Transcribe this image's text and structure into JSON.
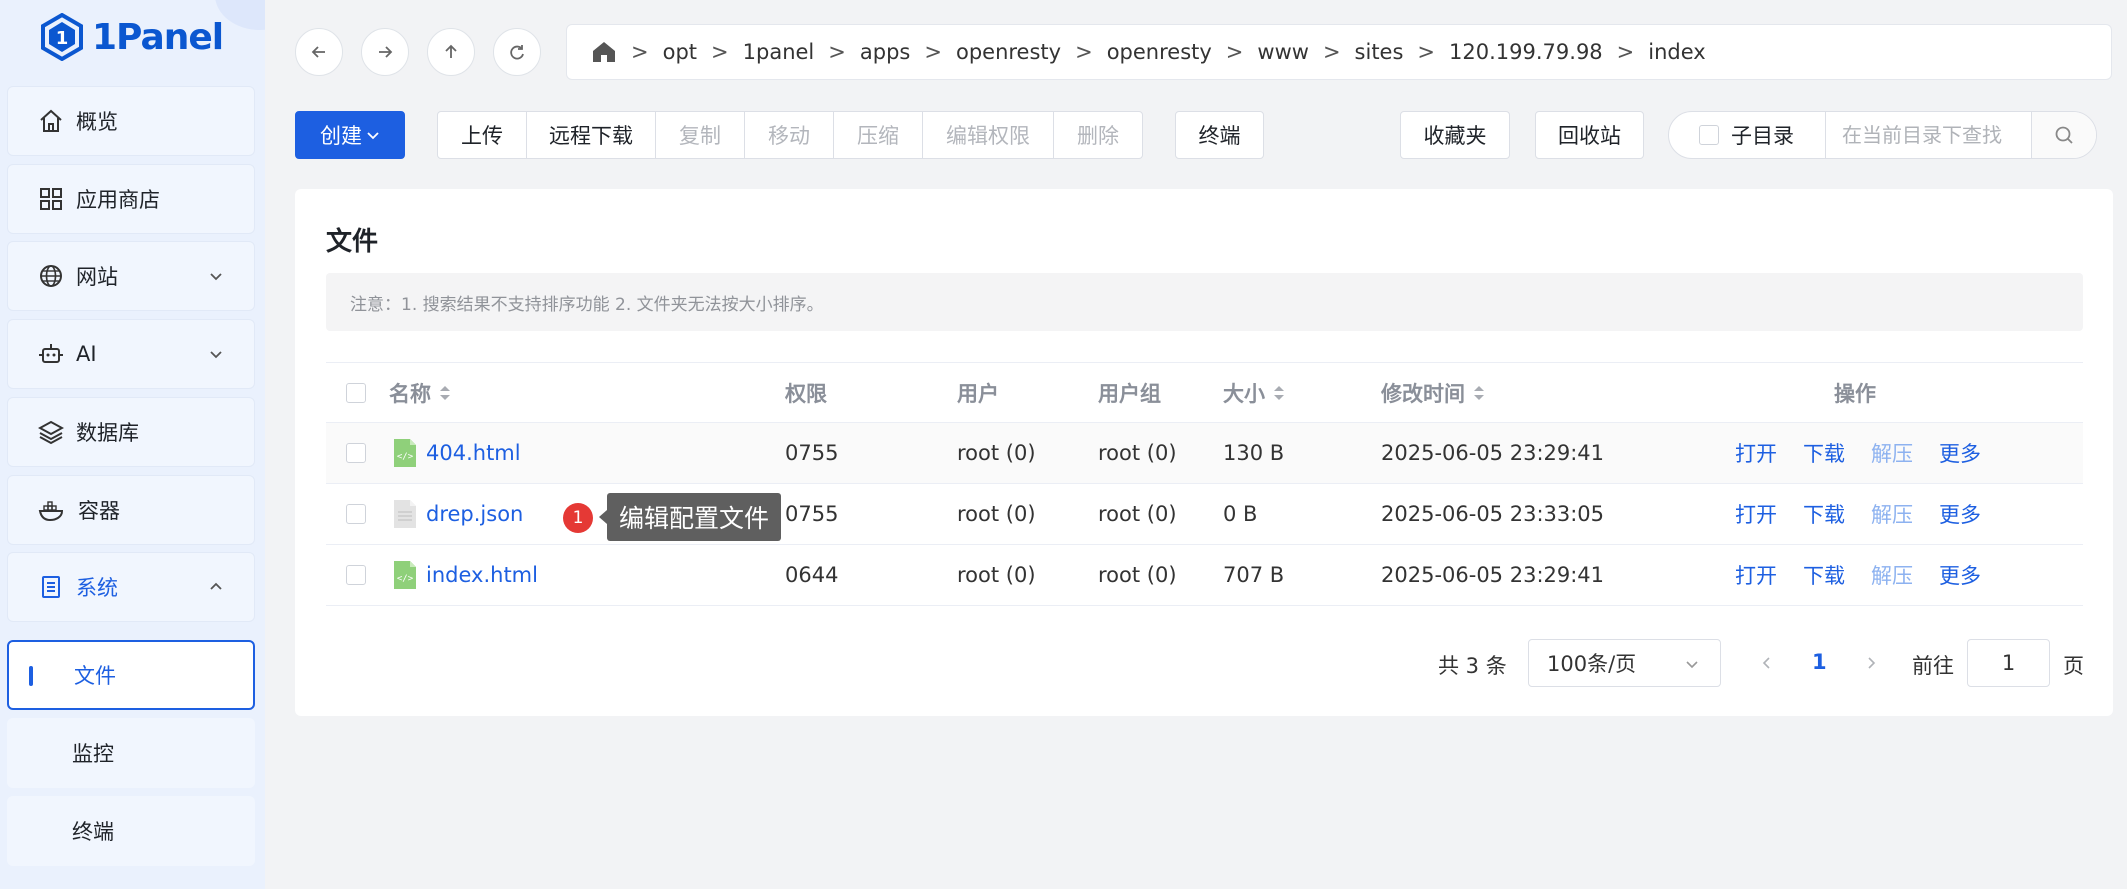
{
  "app": {
    "logo_text": "1Panel"
  },
  "sidebar": {
    "items": [
      {
        "label": "概览",
        "icon": "home-icon"
      },
      {
        "label": "应用商店",
        "icon": "grid-icon"
      },
      {
        "label": "网站",
        "icon": "globe-icon"
      },
      {
        "label": "AI",
        "icon": "robot-icon"
      },
      {
        "label": "数据库",
        "icon": "layers-icon"
      },
      {
        "label": "容器",
        "icon": "docker-icon"
      },
      {
        "label": "系统",
        "icon": "document-icon"
      }
    ],
    "sub_items": [
      {
        "label": "文件"
      },
      {
        "label": "监控"
      },
      {
        "label": "终端"
      }
    ]
  },
  "breadcrumb": [
    "opt",
    "1panel",
    "apps",
    "openresty",
    "openresty",
    "www",
    "sites",
    "120.199.79.98",
    "index"
  ],
  "breadcrumb_sep": ">",
  "toolbar": {
    "create_label": "创建",
    "group": [
      "上传",
      "远程下载",
      "复制",
      "移动",
      "压缩",
      "编辑权限",
      "删除"
    ],
    "terminal_label": "终端",
    "favorites_label": "收藏夹",
    "recycle_label": "回收站",
    "subdir_label": "子目录",
    "search_placeholder": "在当前目录下查找"
  },
  "files": {
    "title": "文件",
    "notice": "注意：1. 搜索结果不支持排序功能 2. 文件夹无法按大小排序。",
    "columns": [
      "名称",
      "权限",
      "用户",
      "用户组",
      "大小",
      "修改时间",
      "操作"
    ],
    "rows": [
      {
        "name": "404.html",
        "perm": "0755",
        "user": "root (0)",
        "group": "root (0)",
        "size": "130 B",
        "mtime": "2025-06-05 23:29:41",
        "type": "html"
      },
      {
        "name": "drep.json",
        "perm": "0755",
        "user": "root (0)",
        "group": "root (0)",
        "size": "0 B",
        "mtime": "2025-06-05 23:33:05",
        "type": "doc"
      },
      {
        "name": "index.html",
        "perm": "0644",
        "user": "root (0)",
        "group": "root (0)",
        "size": "707 B",
        "mtime": "2025-06-05 23:29:41",
        "type": "html"
      }
    ],
    "actions": [
      "打开",
      "下载",
      "解压",
      "更多"
    ]
  },
  "tooltip": {
    "badge": "1",
    "text": "编辑配置文件"
  },
  "pager": {
    "total": "共 3 条",
    "page_size": "100条/页",
    "current_page": "1",
    "goto_label": "前往",
    "goto_value": "1",
    "page_unit": "页"
  },
  "colors": {
    "accent": "#1d5fe1",
    "sidebar_bg": "#eaf1fd",
    "badge": "#e53935"
  }
}
